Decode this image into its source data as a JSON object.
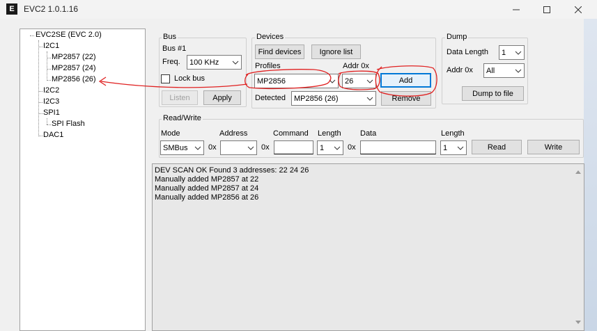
{
  "window": {
    "title": "EVC2 1.0.1.16",
    "app_icon": "E"
  },
  "tree": {
    "root": "EVC2SE (EVC 2.0)",
    "items": [
      "I2C1",
      "MP2857 (22)",
      "MP2857 (24)",
      "MP2856 (26)",
      "I2C2",
      "I2C3",
      "SPI1",
      "SPI Flash",
      "DAC1"
    ]
  },
  "bus": {
    "group_label": "Bus",
    "bus_name": "Bus #1",
    "freq_label": "Freq.",
    "freq_value": "100 KHz",
    "lock_label": "Lock bus",
    "listen_label": "Listen",
    "apply_label": "Apply"
  },
  "devices": {
    "group_label": "Devices",
    "find_label": "Find devices",
    "ignore_label": "Ignore list",
    "profiles_label": "Profiles",
    "profile_value": "MP2856",
    "addr_label": "Addr 0x",
    "addr_value": "26",
    "add_label": "Add",
    "detected_label": "Detected",
    "detected_value": "MP2856 (26)",
    "remove_label": "Remove"
  },
  "dump": {
    "group_label": "Dump",
    "length_label": "Data Length",
    "length_value": "1",
    "addr_label": "Addr 0x",
    "addr_value": "All",
    "dump_label": "Dump to file"
  },
  "readwrite": {
    "group_label": "Read/Write",
    "mode_label": "Mode",
    "mode_value": "SMBus",
    "address_label": "Address",
    "hex_prefix": "0x",
    "command_label": "Command",
    "length_label": "Length",
    "length_value": "1",
    "data_label": "Data",
    "length2_label": "Length",
    "length2_value": "1",
    "read_label": "Read",
    "write_label": "Write"
  },
  "log": {
    "lines": [
      "DEV SCAN OK Found 3 addresses: 22 24 26",
      "Manually added MP2857 at 22",
      "Manually added MP2857 at 24",
      "Manually added MP2856 at 26"
    ]
  },
  "colors": {
    "annotation": "#e02020",
    "focus": "#0078d7"
  }
}
